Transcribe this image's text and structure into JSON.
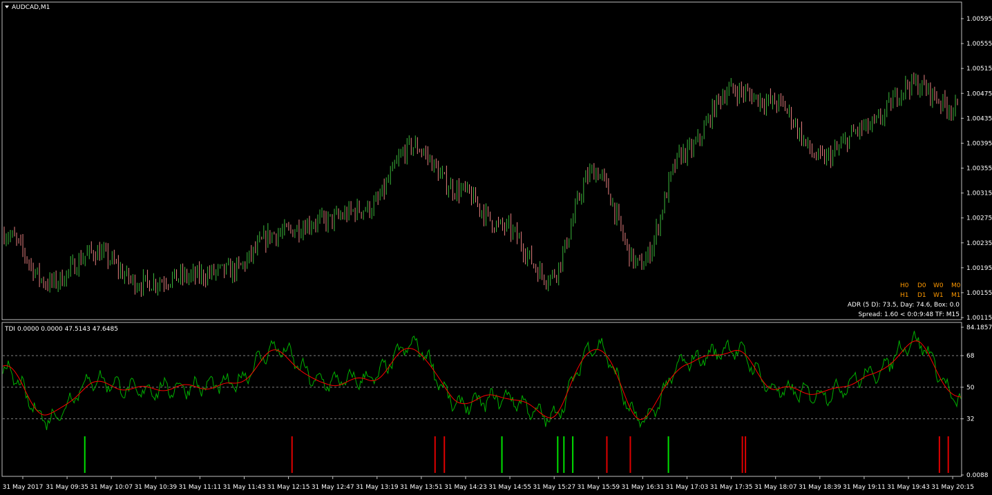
{
  "window": {
    "symbol_title": "AUDCAD,M1",
    "indicator_title": "TDI 0.0000 0.0000 47.5143 47.6485"
  },
  "overlay": {
    "row1": [
      "H0",
      "D0",
      "W0",
      "M0"
    ],
    "row2": [
      "H1",
      "D1",
      "W1",
      "M1"
    ],
    "adr_line": "ADR (5 D): 73.5, Day: 74.6, Box: 0.0",
    "spread_line": "Spread: 1.60  <  0:0:9:48  TF:  M15"
  },
  "colors": {
    "background": "#000000",
    "bull": "#3cb83c",
    "bear": "#e88080",
    "tdi_fast": "#00b000",
    "tdi_slow": "#ff0000",
    "signal_up": "#00e000",
    "signal_down": "#e00000",
    "levels": "#808080",
    "overlay_text": "#ff9900"
  },
  "chart_data": [
    {
      "type": "line",
      "name": "price",
      "symbol": "AUDCAD",
      "timeframe": "M1",
      "ylim": [
        1.00115,
        1.00595
      ],
      "yticks": [
        "1.00595",
        "1.00555",
        "1.00515",
        "1.00475",
        "1.00435",
        "1.00395",
        "1.00355",
        "1.00315",
        "1.00275",
        "1.00235",
        "1.00195",
        "1.00155",
        "1.00115"
      ],
      "x": [
        "31 May 2017",
        "31 May 09:35",
        "31 May 10:07",
        "31 May 10:39",
        "31 May 11:11",
        "31 May 11:43",
        "31 May 12:15",
        "31 May 12:47",
        "31 May 13:19",
        "31 May 13:51",
        "31 May 14:23",
        "31 May 14:55",
        "31 May 15:27",
        "31 May 15:59",
        "31 May 16:31",
        "31 May 17:03",
        "31 May 17:35",
        "31 May 18:07",
        "31 May 18:39",
        "31 May 19:11",
        "31 May 19:43",
        "31 May 20:15"
      ],
      "values": [
        1.0025,
        1.0017,
        1.0022,
        1.0017,
        1.0018,
        1.0019,
        1.0025,
        1.0027,
        1.0029,
        1.0039,
        1.0032,
        1.0026,
        1.0018,
        1.0035,
        1.002,
        1.0038,
        1.0048,
        1.0046,
        1.0037,
        1.0042,
        1.0049,
        1.0045
      ],
      "key_points": {
        "high": 1.0059,
        "low": 1.0013
      }
    },
    {
      "type": "line",
      "name": "TDI",
      "ylim": [
        0.0088,
        84.1857
      ],
      "yticks": [
        "84.1857",
        "68",
        "50",
        "32",
        "0.0088"
      ],
      "levels": [
        68,
        50,
        32
      ],
      "x": [
        "31 May 2017",
        "31 May 09:35",
        "31 May 10:07",
        "31 May 10:39",
        "31 May 11:11",
        "31 May 11:43",
        "31 May 12:15",
        "31 May 12:47",
        "31 May 13:19",
        "31 May 13:51",
        "31 May 14:23",
        "31 May 14:55",
        "31 May 15:27",
        "31 May 15:59",
        "31 May 16:31",
        "31 May 17:03",
        "31 May 17:35",
        "31 May 18:07",
        "31 May 18:39",
        "31 May 19:11",
        "31 May 19:43",
        "31 May 20:15"
      ],
      "series": [
        {
          "values": [
            60,
            32,
            54,
            48,
            50,
            52,
            72,
            53,
            55,
            74,
            40,
            44,
            33,
            74,
            31,
            65,
            72,
            48,
            46,
            57,
            76,
            42
          ]
        },
        {
          "values": [
            62,
            34,
            52,
            49,
            50,
            51,
            70,
            52,
            54,
            72,
            42,
            45,
            34,
            73,
            33,
            64,
            71,
            49,
            47,
            56,
            75,
            43
          ]
        }
      ],
      "signals": [
        {
          "time_index": 1.4,
          "direction": "up"
        },
        {
          "time_index": 6.08,
          "direction": "down"
        },
        {
          "time_index": 9.31,
          "direction": "down"
        },
        {
          "time_index": 9.52,
          "direction": "down"
        },
        {
          "time_index": 10.82,
          "direction": "up"
        },
        {
          "time_index": 12.08,
          "direction": "up"
        },
        {
          "time_index": 12.22,
          "direction": "up"
        },
        {
          "time_index": 12.42,
          "direction": "up"
        },
        {
          "time_index": 13.19,
          "direction": "down"
        },
        {
          "time_index": 13.72,
          "direction": "down"
        },
        {
          "time_index": 14.58,
          "direction": "up"
        },
        {
          "time_index": 16.25,
          "direction": "down"
        },
        {
          "time_index": 16.32,
          "direction": "down"
        },
        {
          "time_index": 20.7,
          "direction": "down"
        },
        {
          "time_index": 20.9,
          "direction": "down"
        }
      ]
    }
  ]
}
